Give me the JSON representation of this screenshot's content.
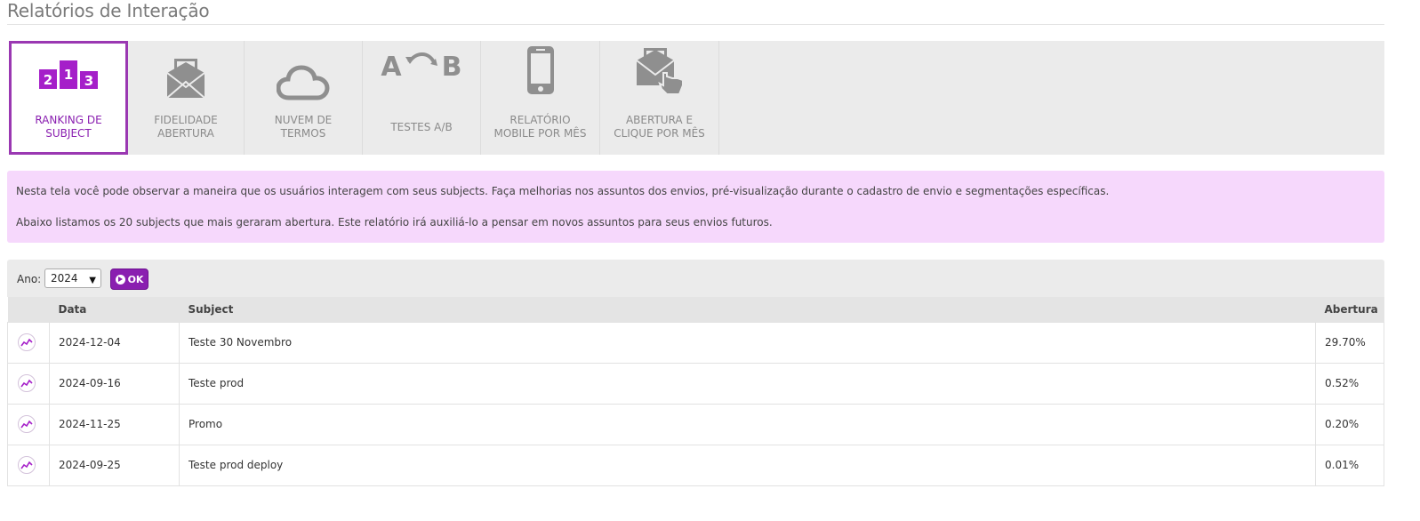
{
  "page": {
    "title": "Relatórios de Interação"
  },
  "tabs": [
    {
      "label_line1": "RANKING DE",
      "label_line2": "SUBJECT",
      "icon": "ranking-podium-icon",
      "active": true
    },
    {
      "label_line1": "FIDELIDADE",
      "label_line2": "ABERTURA",
      "icon": "envelope-open-icon",
      "active": false
    },
    {
      "label_line1": "NUVEM DE",
      "label_line2": "TERMOS",
      "icon": "cloud-icon",
      "active": false
    },
    {
      "label_line1": "TESTES A/B",
      "label_line2": "",
      "icon": "ab-test-icon",
      "active": false
    },
    {
      "label_line1": "RELATÓRIO",
      "label_line2": "MOBILE POR MÊS",
      "icon": "smartphone-icon",
      "active": false
    },
    {
      "label_line1": "ABERTURA E",
      "label_line2": "CLIQUE POR MÊS",
      "icon": "envelope-click-icon",
      "active": false
    }
  ],
  "info": {
    "line1": "Nesta tela você pode observar a maneira que os usuários interagem com seus subjects. Faça melhorias nos assuntos dos envios, pré-visualização durante o cadastro de envio e segmentações específicas.",
    "line2": "Abaixo listamos os 20 subjects que mais geraram abertura. Este relatório irá auxiliá-lo a pensar em novos assuntos para seus envios futuros."
  },
  "filter": {
    "year_label": "Ano:",
    "year_value": "2024",
    "ok_label": "OK"
  },
  "table": {
    "headers": {
      "data": "Data",
      "subject": "Subject",
      "abertura": "Abertura"
    },
    "rows": [
      {
        "data": "2024-12-04",
        "subject": "Teste 30 Novembro",
        "abertura": "29.70%"
      },
      {
        "data": "2024-09-16",
        "subject": "Teste prod",
        "abertura": "0.52%"
      },
      {
        "data": "2024-11-25",
        "subject": "Promo",
        "abertura": "0.20%"
      },
      {
        "data": "2024-09-25",
        "subject": "Teste prod deploy",
        "abertura": "0.01%"
      }
    ]
  },
  "colors": {
    "accent": "#8a1fb0",
    "active_border": "#9a38b2",
    "info_bg": "#f6d8fc",
    "icon_gray": "#8f8f8f"
  }
}
